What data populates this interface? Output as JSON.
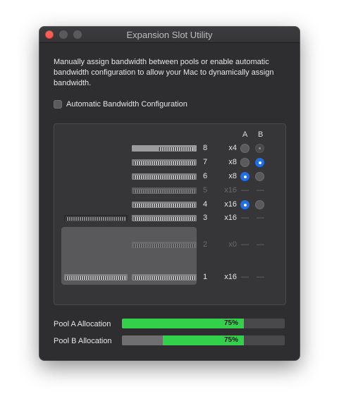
{
  "window": {
    "title": "Expansion Slot Utility",
    "description": "Manually assign bandwidth between pools or enable automatic bandwidth configuration to allow your Mac to dynamically assign bandwidth.",
    "auto_bandwidth": {
      "label": "Automatic Bandwidth Configuration",
      "checked": false
    }
  },
  "columns": {
    "a": "A",
    "b": "B"
  },
  "slots": [
    {
      "number": "8",
      "lanes": "x4",
      "pool": "none"
    },
    {
      "number": "7",
      "lanes": "x8",
      "pool": "B"
    },
    {
      "number": "6",
      "lanes": "x8",
      "pool": "A"
    },
    {
      "number": "5",
      "lanes": "x16",
      "pool": "disabled"
    },
    {
      "number": "4",
      "lanes": "x16",
      "pool": "A"
    },
    {
      "number": "3",
      "lanes": "x16",
      "pool": "fixed"
    },
    {
      "number": "2",
      "lanes": "x0",
      "pool": "disabled"
    },
    {
      "number": "1",
      "lanes": "x16",
      "pool": "fixed"
    }
  ],
  "dash": "—",
  "allocation": {
    "pool_a": {
      "label": "Pool A Allocation",
      "percent": 75,
      "text": "75%"
    },
    "pool_b": {
      "label": "Pool B Allocation",
      "percent": 75,
      "text": "75%",
      "reserved_percent": 25
    }
  },
  "colors": {
    "accent": "#1f6fe8",
    "allocation_green": "#32d04b",
    "close": "#ff5f57"
  }
}
